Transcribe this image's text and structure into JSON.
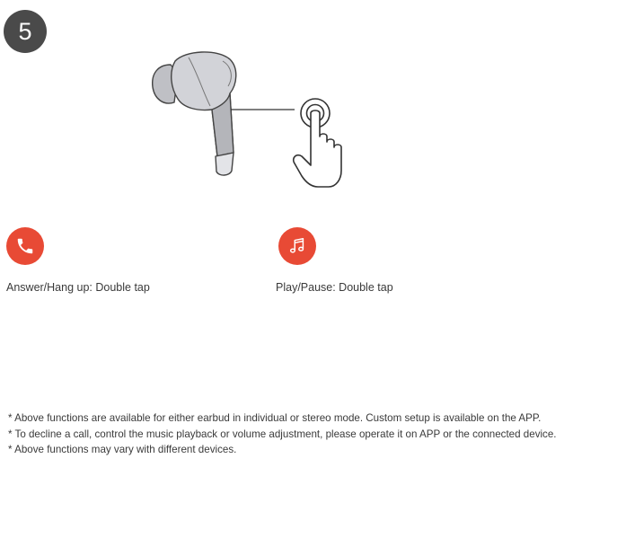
{
  "step": {
    "number": "5"
  },
  "illustration": {
    "earbud": "earbud-icon",
    "gesture": "tap-hand-icon"
  },
  "functions": [
    {
      "icon": "phone-icon",
      "label": "Answer/Hang up: Double tap"
    },
    {
      "icon": "music-note-icon",
      "label": "Play/Pause: Double tap"
    }
  ],
  "notes": [
    "* Above functions are available for either earbud in individual or stereo mode. Custom setup is available on the APP.",
    "* To decline a call, control the music playback or volume adjustment, please operate it on APP or the connected device.",
    "* Above functions may vary with different devices."
  ],
  "colors": {
    "accent": "#e84a35",
    "badge": "#4a4a4a",
    "earbud": "#d2d3d8",
    "stem": "#b4b5ba"
  }
}
